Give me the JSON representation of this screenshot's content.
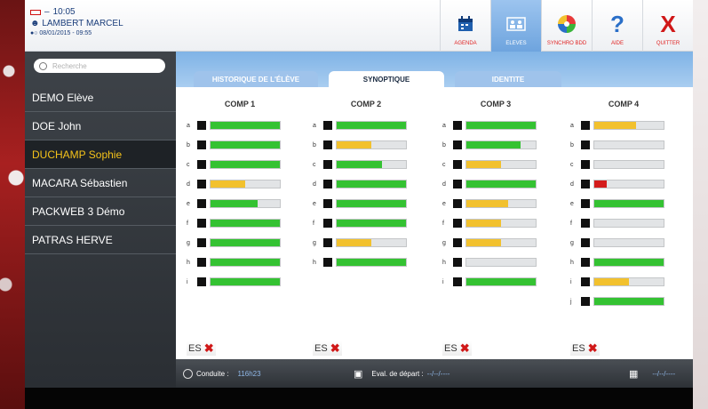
{
  "header": {
    "time": "10:05",
    "user": "LAMBERT MARCEL",
    "datetime": "08/01/2015 - 09:55",
    "toolbar": [
      {
        "label": "AGENDA",
        "icon": "calendar-icon",
        "active": false
      },
      {
        "label": "ELEVES",
        "icon": "students-icon",
        "active": true
      },
      {
        "label": "SYNCHRO BDD",
        "icon": "sync-icon",
        "active": false
      },
      {
        "label": "AIDE",
        "icon": "help-icon",
        "active": false
      },
      {
        "label": "QUITTER",
        "icon": "close-icon",
        "active": false
      }
    ]
  },
  "sidebar": {
    "search_placeholder": "Recherche",
    "students": [
      {
        "name": "DEMO Elève",
        "selected": false
      },
      {
        "name": "DOE John",
        "selected": false
      },
      {
        "name": "DUCHAMP Sophie",
        "selected": true
      },
      {
        "name": "MACARA Sébastien",
        "selected": false
      },
      {
        "name": "PACKWEB 3 Démo",
        "selected": false
      },
      {
        "name": "PATRAS HERVE",
        "selected": false
      }
    ]
  },
  "tabs": [
    {
      "label": "HISTORIQUE DE L'ÉLÈVE",
      "active": false
    },
    {
      "label": "SYNOPTIQUE",
      "active": true
    },
    {
      "label": "IDENTITE",
      "active": false
    }
  ],
  "colors": {
    "green": "#34c232",
    "yellow": "#f2c12e",
    "red": "#d41c1c",
    "empty": "#e2e4e6"
  },
  "competences": [
    {
      "title": "COMP 1",
      "es_label": "ES",
      "rows": [
        {
          "letter": "a",
          "level": 1.0,
          "color": "green"
        },
        {
          "letter": "b",
          "level": 1.0,
          "color": "green"
        },
        {
          "letter": "c",
          "level": 1.0,
          "color": "green"
        },
        {
          "letter": "d",
          "level": 0.5,
          "color": "yellow"
        },
        {
          "letter": "e",
          "level": 0.68,
          "color": "green"
        },
        {
          "letter": "f",
          "level": 1.0,
          "color": "green"
        },
        {
          "letter": "g",
          "level": 1.0,
          "color": "green"
        },
        {
          "letter": "h",
          "level": 1.0,
          "color": "green"
        },
        {
          "letter": "i",
          "level": 1.0,
          "color": "green"
        }
      ]
    },
    {
      "title": "COMP 2",
      "es_label": "ES",
      "rows": [
        {
          "letter": "a",
          "level": 1.0,
          "color": "green"
        },
        {
          "letter": "b",
          "level": 0.5,
          "color": "yellow"
        },
        {
          "letter": "c",
          "level": 0.65,
          "color": "green"
        },
        {
          "letter": "d",
          "level": 1.0,
          "color": "green"
        },
        {
          "letter": "e",
          "level": 1.0,
          "color": "green"
        },
        {
          "letter": "f",
          "level": 1.0,
          "color": "green"
        },
        {
          "letter": "g",
          "level": 0.5,
          "color": "yellow"
        },
        {
          "letter": "h",
          "level": 1.0,
          "color": "green"
        }
      ]
    },
    {
      "title": "COMP 3",
      "es_label": "ES",
      "rows": [
        {
          "letter": "a",
          "level": 1.0,
          "color": "green"
        },
        {
          "letter": "b",
          "level": 0.78,
          "color": "green"
        },
        {
          "letter": "c",
          "level": 0.5,
          "color": "yellow"
        },
        {
          "letter": "d",
          "level": 1.0,
          "color": "green"
        },
        {
          "letter": "e",
          "level": 0.6,
          "color": "yellow"
        },
        {
          "letter": "f",
          "level": 0.5,
          "color": "yellow"
        },
        {
          "letter": "g",
          "level": 0.5,
          "color": "yellow"
        },
        {
          "letter": "h",
          "level": 0.0,
          "color": "green"
        },
        {
          "letter": "i",
          "level": 1.0,
          "color": "green"
        }
      ]
    },
    {
      "title": "COMP 4",
      "es_label": "ES",
      "rows": [
        {
          "letter": "a",
          "level": 0.6,
          "color": "yellow"
        },
        {
          "letter": "b",
          "level": 0.0,
          "color": "green"
        },
        {
          "letter": "c",
          "level": 0.0,
          "color": "green"
        },
        {
          "letter": "d",
          "level": 0.18,
          "color": "red"
        },
        {
          "letter": "e",
          "level": 1.0,
          "color": "green"
        },
        {
          "letter": "f",
          "level": 0.0,
          "color": "green"
        },
        {
          "letter": "g",
          "level": 0.0,
          "color": "green"
        },
        {
          "letter": "h",
          "level": 1.0,
          "color": "green"
        },
        {
          "letter": "i",
          "level": 0.5,
          "color": "yellow"
        },
        {
          "letter": "j",
          "level": 1.0,
          "color": "green"
        }
      ]
    }
  ],
  "footer": {
    "conduite_label": "Conduite :",
    "conduite_value": "116h23",
    "eval_label": "Eval. de départ :",
    "eval_value": "--/--/----",
    "date_value": "--/--/----"
  }
}
